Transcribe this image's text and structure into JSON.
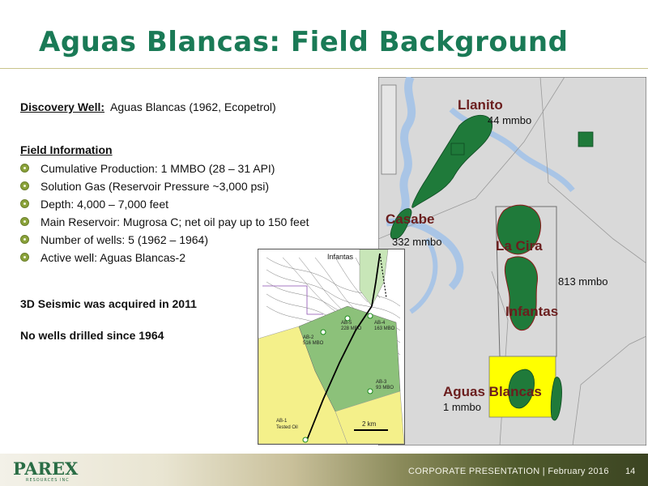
{
  "title": "Aguas Blancas: Field Background",
  "discovery": {
    "label": "Discovery Well:",
    "value": "Aguas Blancas (1962, Ecopetrol)"
  },
  "field_info": {
    "heading": "Field Information",
    "bullets": [
      "Cumulative Production:   1 MMBO (28 – 31 API)",
      "Solution Gas (Reservoir Pressure ~3,000 psi)",
      "Depth: 4,000 – 7,000 feet",
      "Main Reservoir: Mugrosa  C; net oil pay up to 150 feet",
      "Number of wells: 5 (1962 – 1964)",
      "Active well: Aguas Blancas-2"
    ]
  },
  "notes": [
    "3D Seismic was acquired in 2011",
    "No wells drilled since 1964"
  ],
  "map": {
    "labels": {
      "llanito": "Llanito",
      "llanito_vol": "44 mmbo",
      "casabe": "Casabe",
      "casabe_vol": "332 mmbo",
      "la_cira": "La Cira",
      "la_cira_vol": "813 mmbo",
      "infantas": "Infantas",
      "aguas_blancas": "Aguas Blancas",
      "aguas_blancas_vol": "1 mmbo"
    }
  },
  "inset": {
    "title": "Infantas",
    "wells": [
      {
        "name": "AB-5",
        "vol": "228 MBO"
      },
      {
        "name": "AB-4",
        "vol": "163 MBO"
      },
      {
        "name": "AB-2",
        "vol": "516 MBO"
      },
      {
        "name": "AB-3",
        "vol": "93 MBO"
      },
      {
        "name": "AB-1",
        "vol": "Tested Oil"
      }
    ],
    "scale": "2 km"
  },
  "footer": {
    "text": "CORPORATE PRESENTATION | February 2016",
    "page": "14",
    "logo": "PAREX",
    "logo_sub": "RESOURCES INC"
  },
  "colors": {
    "title": "#1a7a56",
    "field_green": "#1f7a3a",
    "aguas_blancas_block": "#ffff00",
    "river": "#b4cde8"
  }
}
